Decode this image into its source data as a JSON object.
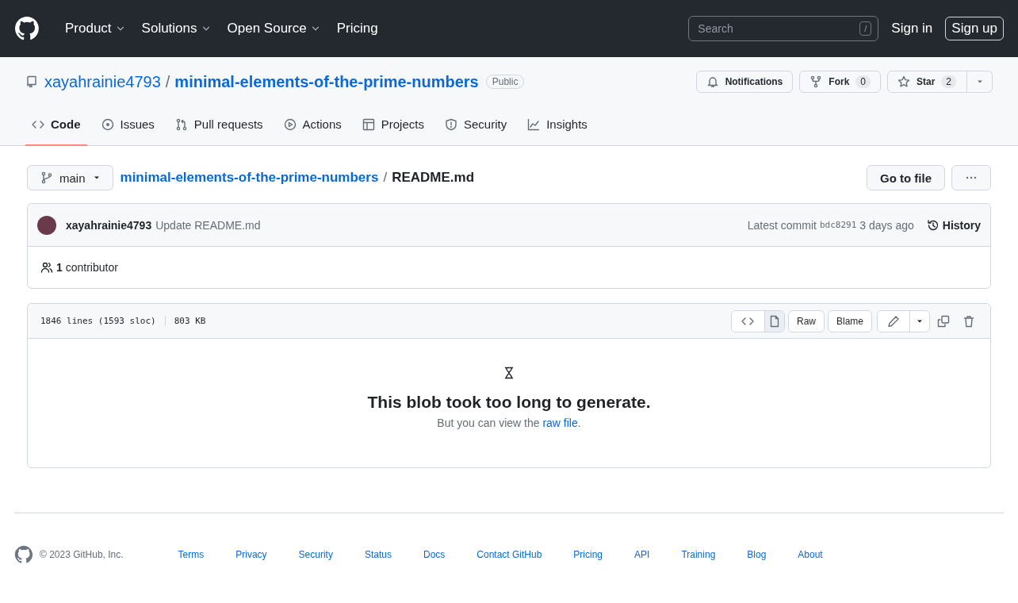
{
  "header": {
    "nav": [
      {
        "label": "Product",
        "has_menu": true
      },
      {
        "label": "Solutions",
        "has_menu": true
      },
      {
        "label": "Open Source",
        "has_menu": true
      },
      {
        "label": "Pricing",
        "has_menu": false
      }
    ],
    "search": {
      "placeholder": "Search",
      "key": "/"
    },
    "sign_in": "Sign in",
    "sign_up": "Sign up"
  },
  "repo": {
    "owner": "xayahrainie4793",
    "separator": "/",
    "name": "minimal-elements-of-the-prime-numbers",
    "visibility": "Public",
    "notifications": "Notifications",
    "fork": {
      "label": "Fork",
      "count": "0"
    },
    "star": {
      "label": "Star",
      "count": "2"
    }
  },
  "tabs": [
    {
      "label": "Code",
      "selected": true
    },
    {
      "label": "Issues",
      "selected": false
    },
    {
      "label": "Pull requests",
      "selected": false
    },
    {
      "label": "Actions",
      "selected": false
    },
    {
      "label": "Projects",
      "selected": false
    },
    {
      "label": "Security",
      "selected": false
    },
    {
      "label": "Insights",
      "selected": false
    }
  ],
  "path": {
    "branch": "main",
    "repo_link": "minimal-elements-of-the-prime-numbers",
    "separator": "/",
    "file": "README.md",
    "go_to_file": "Go to file"
  },
  "commit": {
    "author": "xayahrainie4793",
    "message": "Update README.md",
    "label": "Latest commit",
    "sha": "bdc8291",
    "time": "3 days ago",
    "history": "History"
  },
  "contributors": {
    "count": "1",
    "label": "contributor"
  },
  "blob": {
    "lines": "1846 lines (1593 sloc)",
    "size": "803 KB",
    "view_modes": [
      {
        "selected": false
      },
      {
        "selected": true
      }
    ],
    "raw": "Raw",
    "blame": "Blame",
    "title": "This blob took too long to generate.",
    "text": "But you can view the",
    "link": "raw file",
    "end": "."
  },
  "footer": {
    "copyright": "© 2023 GitHub, Inc.",
    "links": [
      "Terms",
      "Privacy",
      "Security",
      "Status",
      "Docs",
      "Contact GitHub",
      "Pricing",
      "API",
      "Training",
      "Blog",
      "About"
    ]
  }
}
